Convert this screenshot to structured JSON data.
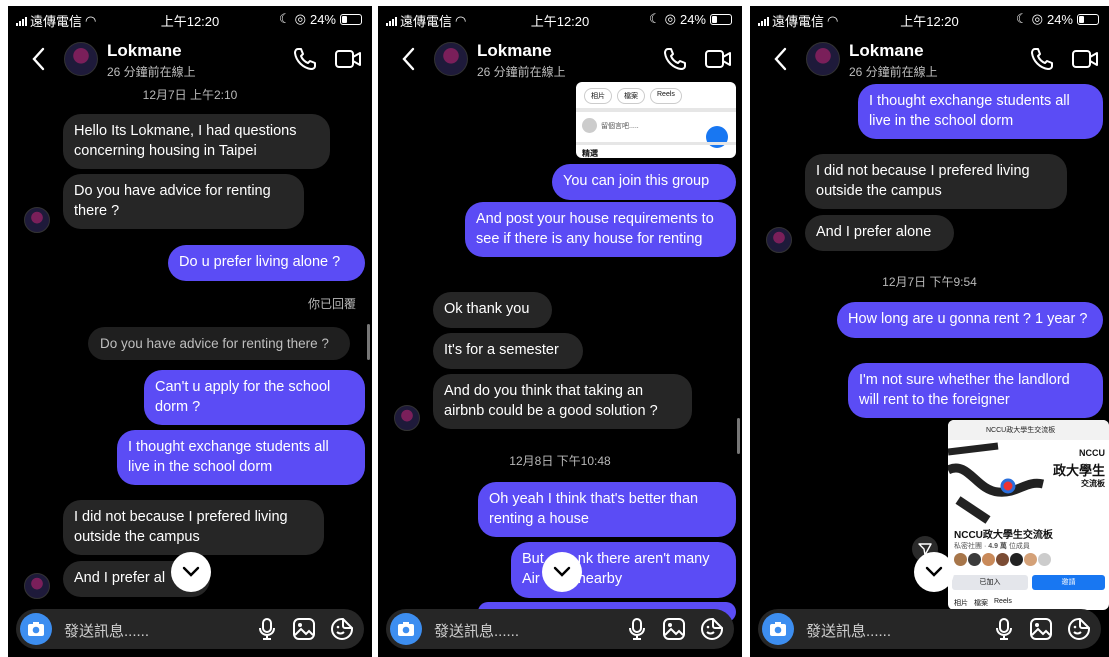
{
  "status": {
    "carrier": "遠傳電信",
    "time": "上午12:20",
    "battery": "24%"
  },
  "header": {
    "name": "Lokmane",
    "subtitle": "26 分鐘前在線上"
  },
  "compose": {
    "placeholder": "發送訊息......"
  },
  "screen1": {
    "timestamp": "12月7日 上午2:10",
    "msg1": "Hello Its Lokmane, I had questions concerning housing in Taipei",
    "msg2": "Do you have advice for renting there ?",
    "msg3": "Do u prefer living alone ?",
    "replied_label": "你已回覆",
    "quoted": "Do you have advice for renting there ?",
    "msg4": "Can't u apply for the school dorm ?",
    "msg5": "I thought exchange students all live in the school dorm",
    "msg6": "I did not because I prefered living outside the campus",
    "msg7": "And I prefer al"
  },
  "screen2": {
    "shot_tabs": [
      "相片",
      "檔案",
      "Reels"
    ],
    "shot_input": "留個言吧.....",
    "shot_footer": "精選",
    "msg1": "You can join this group",
    "msg2": "And post your house requirements to see if there is any house for renting",
    "msg3": "Ok thank you",
    "msg4": "It's for a semester",
    "msg5": "And do you think that taking an airbnb could be a good solution ?",
    "timestamp": "12月8日 下午10:48",
    "msg6": "Oh yeah I think that's better than renting a house",
    "msg7_a": "But",
    "msg7_b": "nk there aren't many",
    "msg7_c": "Air",
    "msg7_d": "nearby"
  },
  "screen3": {
    "msg1": "I thought exchange students all live in the school dorm",
    "msg2": "I did not because I prefered living outside the campus",
    "msg3": "And I prefer alone",
    "timestamp": "12月7日 下午9:54",
    "msg4": "How long are u gonna rent ? 1 year ?",
    "msg5": "I'm not sure whether the landlord will rent to the foreigner",
    "card_topbar": "NCCU政大學生交流板",
    "card_banner_top": "NCCU",
    "card_banner_main": "政大學生",
    "card_banner_sub": "交流板",
    "card_title": "NCCU政大學生交流板",
    "card_meta_a": "私密社團 ·",
    "card_meta_count": "4.9 萬",
    "card_meta_b": "位成員",
    "card_joined": "已加入",
    "card_invite": "邀請",
    "card_tabs": [
      "相片",
      "檔案",
      "Reels"
    ]
  }
}
